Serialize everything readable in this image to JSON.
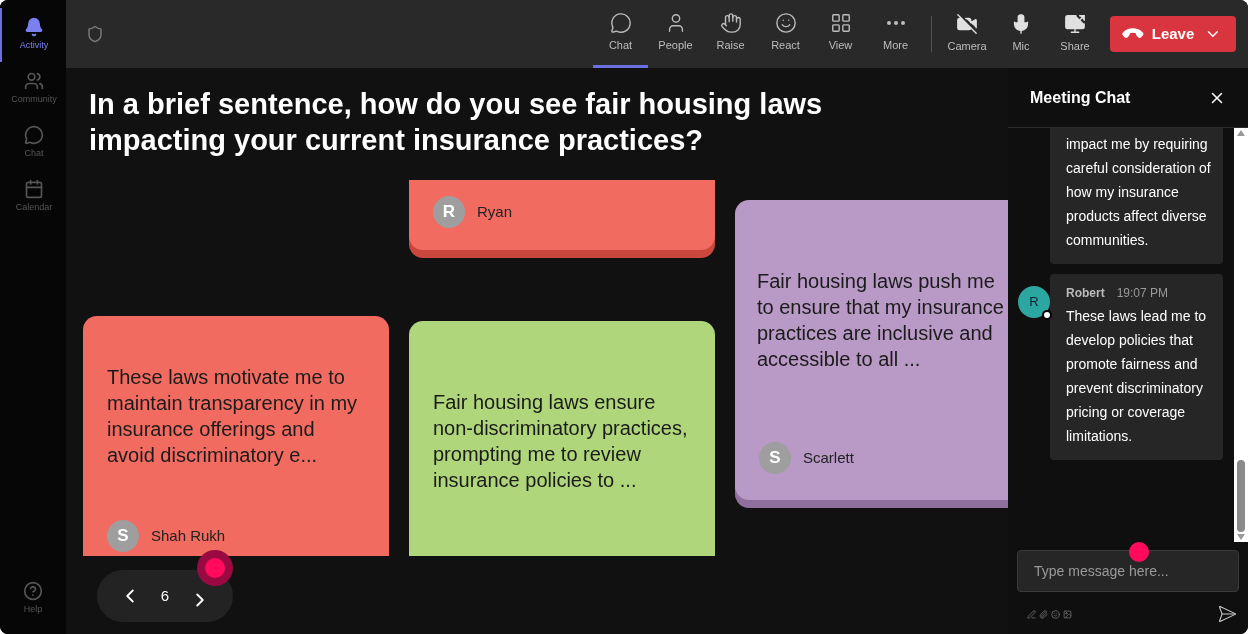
{
  "sidebar": {
    "items": [
      {
        "label": "Activity",
        "selected": true
      },
      {
        "label": "Community",
        "selected": false
      },
      {
        "label": "Chat",
        "selected": false
      },
      {
        "label": "Calendar",
        "selected": false
      }
    ],
    "help": {
      "label": "Help"
    }
  },
  "toolbar": {
    "items": [
      {
        "label": "Chat",
        "selected": true
      },
      {
        "label": "People",
        "selected": false
      },
      {
        "label": "Raise",
        "selected": false
      },
      {
        "label": "React",
        "selected": false
      },
      {
        "label": "View",
        "selected": false
      },
      {
        "label": "More",
        "selected": false
      }
    ],
    "devices": [
      {
        "label": "Camera"
      },
      {
        "label": "Mic"
      },
      {
        "label": "Share"
      }
    ],
    "leave": {
      "label": "Leave"
    }
  },
  "question": "In a brief sentence, how do you see fair housing laws impacting your current insurance practices?",
  "cards": [
    {
      "author": "Ryan",
      "initial": "R",
      "color": "#f26b60"
    },
    {
      "text": "These laws motivate me to maintain transparency in my insurance offerings and avoid discriminatory e...",
      "author": "Shah Rukh",
      "initial": "S",
      "color": "#f26b60"
    },
    {
      "text": "Fair housing laws ensure non-discriminatory practices, prompting me to review insurance policies to ...",
      "color": "#afd67a"
    },
    {
      "text": "Fair housing laws push me to ensure that my insurance practices are inclusive and accessible to all ...",
      "author": "Scarlett",
      "initial": "S",
      "color": "#b999c6"
    }
  ],
  "pager": {
    "page": "6"
  },
  "chat": {
    "title": "Meeting Chat",
    "messages": [
      {
        "text": "impact me by requiring careful consideration of how my insurance products affect diverse communities."
      },
      {
        "author": "Robert",
        "time": "19:07 PM",
        "initial": "R",
        "text": "These laws lead me to develop policies that promote fairness and prevent discriminatory pricing or coverage limitations."
      }
    ],
    "input": {
      "placeholder": "Type message here..."
    }
  }
}
